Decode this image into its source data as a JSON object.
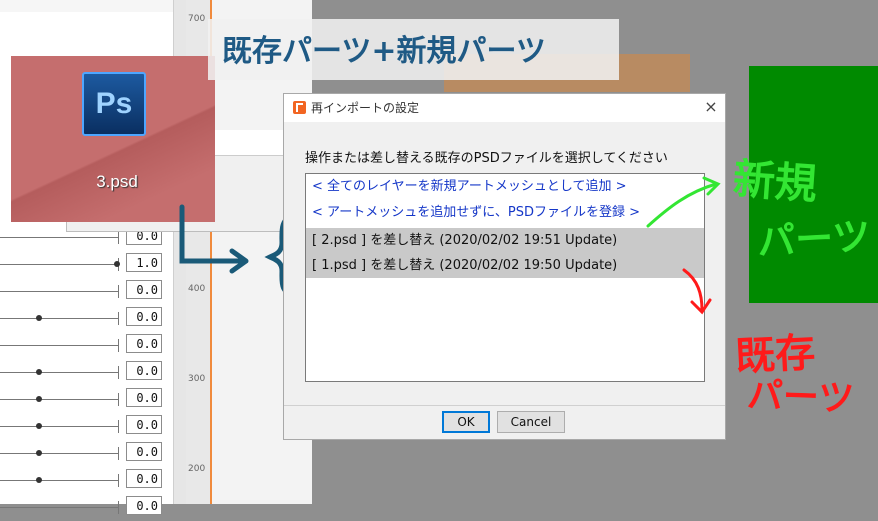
{
  "banner": {
    "text": "既存パーツ+新規パーツ"
  },
  "ps_file": {
    "icon_text": "Ps",
    "filename": "3.psd"
  },
  "param_panel": {
    "values": [
      "0.0",
      "1.0",
      "0.0",
      "0.0",
      "0.0",
      "0.0",
      "0.0",
      "0.0",
      "0.0",
      "0.0",
      "0.0"
    ]
  },
  "ruler": {
    "labels": [
      "700",
      "400",
      "300",
      "200"
    ]
  },
  "dialog": {
    "title": "再インポートの設定",
    "close_glyph": "×",
    "instruction": "操作または差し替える既存のPSDファイルを選択してください",
    "options": [
      "< 全てのレイヤーを新規アートメッシュとして追加 >",
      "< アートメッシュを追加せずに、PSDファイルを登録 >",
      "[ 2.psd ] を差し替え (2020/02/02 19:51 Update)",
      "[ 1.psd ] を差し替え (2020/02/02 19:50 Update)"
    ],
    "ok_label": "OK",
    "cancel_label": "Cancel"
  },
  "annotations": {
    "new_parts_1": "新規",
    "new_parts_2": "パーツ",
    "existing_parts_1": "既存",
    "existing_parts_2": "パーツ"
  },
  "colors": {
    "banner_text": "#1f5a85",
    "green_note": "#33e633",
    "red_note": "#ff1a1a",
    "arrow_blue": "#1a5a78",
    "selected_row": "#c9c9c9"
  }
}
